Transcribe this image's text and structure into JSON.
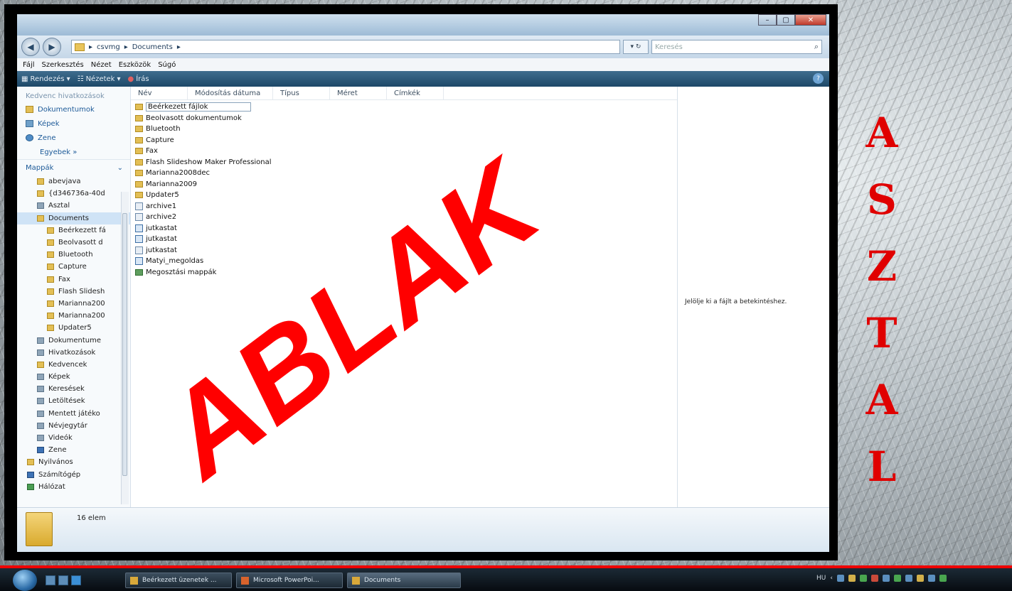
{
  "desktop": {
    "vertical_letters": [
      "A",
      "S",
      "Z",
      "T",
      "A",
      "L"
    ]
  },
  "watermark": "ABLAK",
  "window": {
    "address": {
      "crumbs": [
        "csvmg",
        "Documents"
      ],
      "search_placeholder": "Keresés"
    },
    "menubar": [
      "Fájl",
      "Szerkesztés",
      "Nézet",
      "Eszközök",
      "Súgó"
    ],
    "toolbar": {
      "organize": "Rendezés",
      "views": "Nézetek",
      "burn": "Írás"
    },
    "nav": {
      "favorites_head": "Kedvenc hivatkozások",
      "favorites": [
        "Dokumentumok",
        "Képek",
        "Zene"
      ],
      "more": "Egyebek »",
      "folders_head": "Mappák",
      "tree": [
        {
          "label": "abevjava",
          "indent": 2,
          "icon": "folder"
        },
        {
          "label": "{d346736a-40d",
          "indent": 2,
          "icon": "folder"
        },
        {
          "label": "Asztal",
          "indent": 2,
          "icon": "gray"
        },
        {
          "label": "Documents",
          "indent": 2,
          "icon": "folder",
          "selected": true
        },
        {
          "label": "Beérkezett fá",
          "indent": 3,
          "icon": "folder"
        },
        {
          "label": "Beolvasott d",
          "indent": 3,
          "icon": "folder"
        },
        {
          "label": "Bluetooth",
          "indent": 3,
          "icon": "folder"
        },
        {
          "label": "Capture",
          "indent": 3,
          "icon": "folder"
        },
        {
          "label": "Fax",
          "indent": 3,
          "icon": "folder"
        },
        {
          "label": "Flash Slidesh",
          "indent": 3,
          "icon": "folder"
        },
        {
          "label": "Marianna200",
          "indent": 3,
          "icon": "folder"
        },
        {
          "label": "Marianna200",
          "indent": 3,
          "icon": "folder"
        },
        {
          "label": "Updater5",
          "indent": 3,
          "icon": "folder"
        },
        {
          "label": "Dokumentume",
          "indent": 2,
          "icon": "gray"
        },
        {
          "label": "Hivatkozások",
          "indent": 2,
          "icon": "gray"
        },
        {
          "label": "Kedvencek",
          "indent": 2,
          "icon": "folder"
        },
        {
          "label": "Képek",
          "indent": 2,
          "icon": "gray"
        },
        {
          "label": "Keresések",
          "indent": 2,
          "icon": "gray"
        },
        {
          "label": "Letöltések",
          "indent": 2,
          "icon": "gray"
        },
        {
          "label": "Mentett játéko",
          "indent": 2,
          "icon": "gray"
        },
        {
          "label": "Névjegytár",
          "indent": 2,
          "icon": "gray"
        },
        {
          "label": "Videók",
          "indent": 2,
          "icon": "gray"
        },
        {
          "label": "Zene",
          "indent": 2,
          "icon": "blue"
        },
        {
          "label": "Nyilvános",
          "indent": 1,
          "icon": "folder"
        },
        {
          "label": "Számítógép",
          "indent": 1,
          "icon": "blue"
        },
        {
          "label": "Hálózat",
          "indent": 1,
          "icon": "green"
        }
      ]
    },
    "columns": [
      "Név",
      "Módosítás dátuma",
      "Típus",
      "Méret",
      "Címkék"
    ],
    "files": [
      {
        "name": "Beérkezett fájlok",
        "icon": "folder",
        "focus": true
      },
      {
        "name": "Beolvasott dokumentumok",
        "icon": "folder"
      },
      {
        "name": "Bluetooth",
        "icon": "folder"
      },
      {
        "name": "Capture",
        "icon": "folder"
      },
      {
        "name": "Fax",
        "icon": "folder"
      },
      {
        "name": "Flash Slideshow Maker Professional",
        "icon": "folder"
      },
      {
        "name": "Marianna2008dec",
        "icon": "folder"
      },
      {
        "name": "Marianna2009",
        "icon": "folder"
      },
      {
        "name": "Updater5",
        "icon": "folder"
      },
      {
        "name": "archive1",
        "icon": "arch"
      },
      {
        "name": "archive2",
        "icon": "arch"
      },
      {
        "name": "jutkastat",
        "icon": "doc"
      },
      {
        "name": "jutkastat",
        "icon": "doc"
      },
      {
        "name": "jutkastat",
        "icon": "arch"
      },
      {
        "name": "Matyi_megoldas",
        "icon": "doc"
      },
      {
        "name": "Megosztási mappák",
        "icon": "share"
      }
    ],
    "preview_message": "Jelölje ki a fájlt a betekintéshez.",
    "details_count": "16 elem"
  },
  "taskbar": {
    "buttons": [
      "Beérkezett üzenetek ...",
      "Microsoft PowerPoi...",
      "Documents"
    ],
    "tray_lang": "HU"
  }
}
